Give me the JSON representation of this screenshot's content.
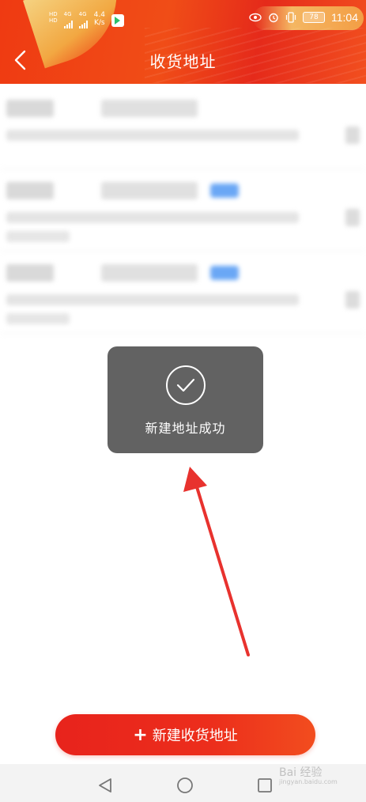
{
  "status_bar": {
    "sim1": "HD",
    "sim2": "HD",
    "network1": "4G",
    "network2": "4G",
    "speed": "4.4",
    "speed_unit": "K/s",
    "battery": "78",
    "time": "11:04"
  },
  "header": {
    "title": "收货地址"
  },
  "addresses": [
    {
      "has_tag": false
    },
    {
      "has_tag": true
    },
    {
      "has_tag": true
    }
  ],
  "toast": {
    "message": "新建地址成功"
  },
  "add_button": {
    "label": "新建收货地址"
  },
  "watermark": {
    "text": "Bai 经验",
    "sub": "jingyan.baidu.com"
  },
  "colors": {
    "header_red": "#ef3a12",
    "button_red": "#e8231c",
    "toast_bg": "#555555",
    "arrow": "#e8322e",
    "tag_blue": "#6aa7f5"
  }
}
